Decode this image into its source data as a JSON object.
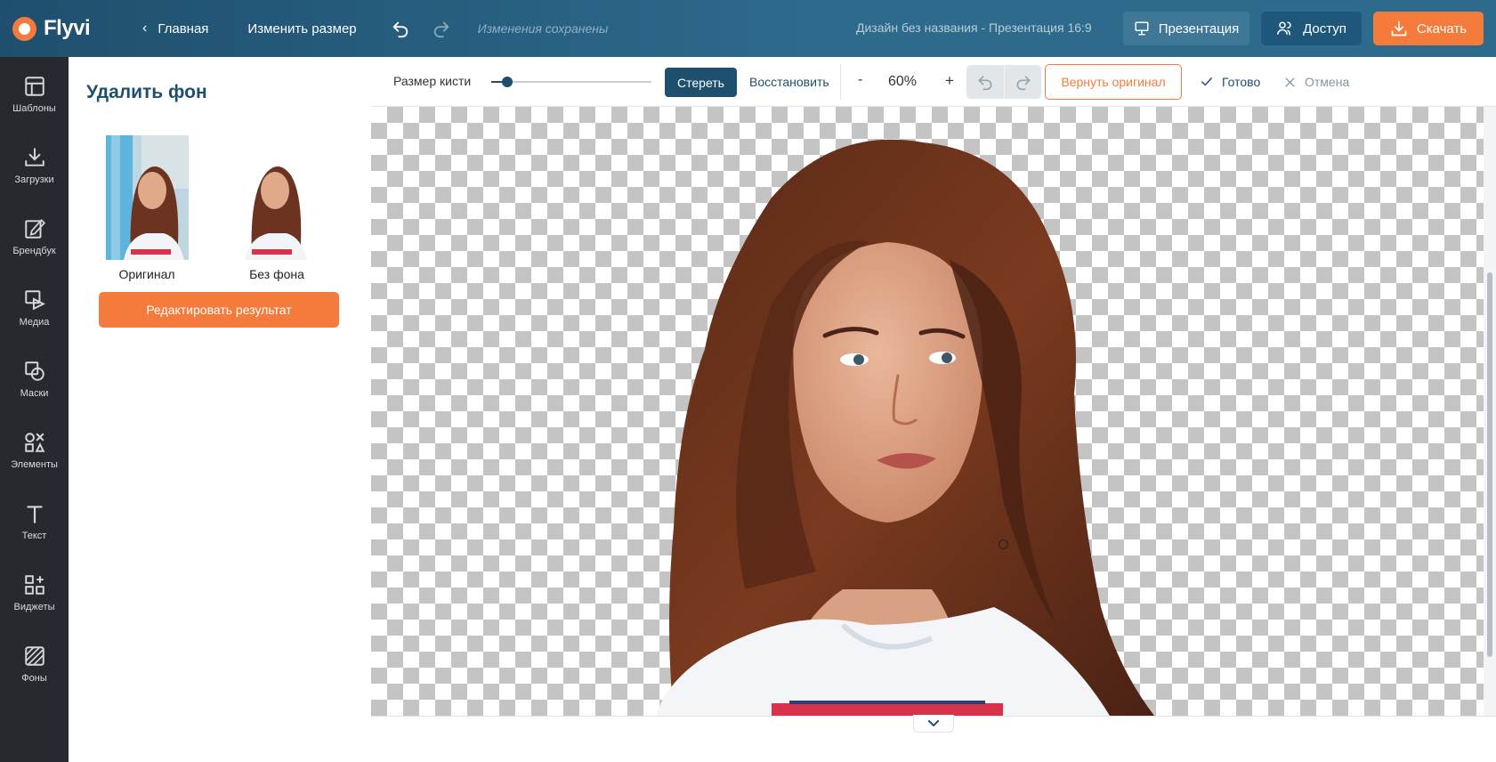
{
  "app": {
    "name": "Flyvi"
  },
  "header": {
    "home_label": "Главная",
    "resize_label": "Изменить размер",
    "save_status": "Изменения сохранены",
    "doc_title": "Дизайн без названия - Презентация 16:9",
    "present_label": "Презентация",
    "access_label": "Доступ",
    "download_label": "Скачать"
  },
  "sidebar": {
    "items": [
      {
        "label": "Шаблоны",
        "icon": "templates-icon"
      },
      {
        "label": "Загрузки",
        "icon": "upload-icon"
      },
      {
        "label": "Брендбук",
        "icon": "brandbook-icon"
      },
      {
        "label": "Медиа",
        "icon": "media-icon"
      },
      {
        "label": "Маски",
        "icon": "masks-icon"
      },
      {
        "label": "Элементы",
        "icon": "elements-icon"
      },
      {
        "label": "Текст",
        "icon": "text-icon"
      },
      {
        "label": "Виджеты",
        "icon": "widgets-icon"
      },
      {
        "label": "Фоны",
        "icon": "backgrounds-icon"
      }
    ]
  },
  "panel": {
    "title": "Удалить фон",
    "original_label": "Оригинал",
    "no_bg_label": "Без фона",
    "edit_button": "Редактировать результат"
  },
  "toolbar": {
    "brush_size_label": "Размер кисти",
    "brush_size_value": 0.1,
    "erase_label": "Стереть",
    "restore_label": "Восстановить",
    "zoom_minus": "-",
    "zoom_value": "60%",
    "zoom_plus": "+",
    "revert_label": "Вернуть оригинал",
    "done_label": "Готово",
    "cancel_label": "Отмена"
  },
  "colors": {
    "header": "#2d6a8c",
    "primary": "#1f4f6e",
    "accent": "#f47b3c",
    "rail": "#27292e"
  }
}
